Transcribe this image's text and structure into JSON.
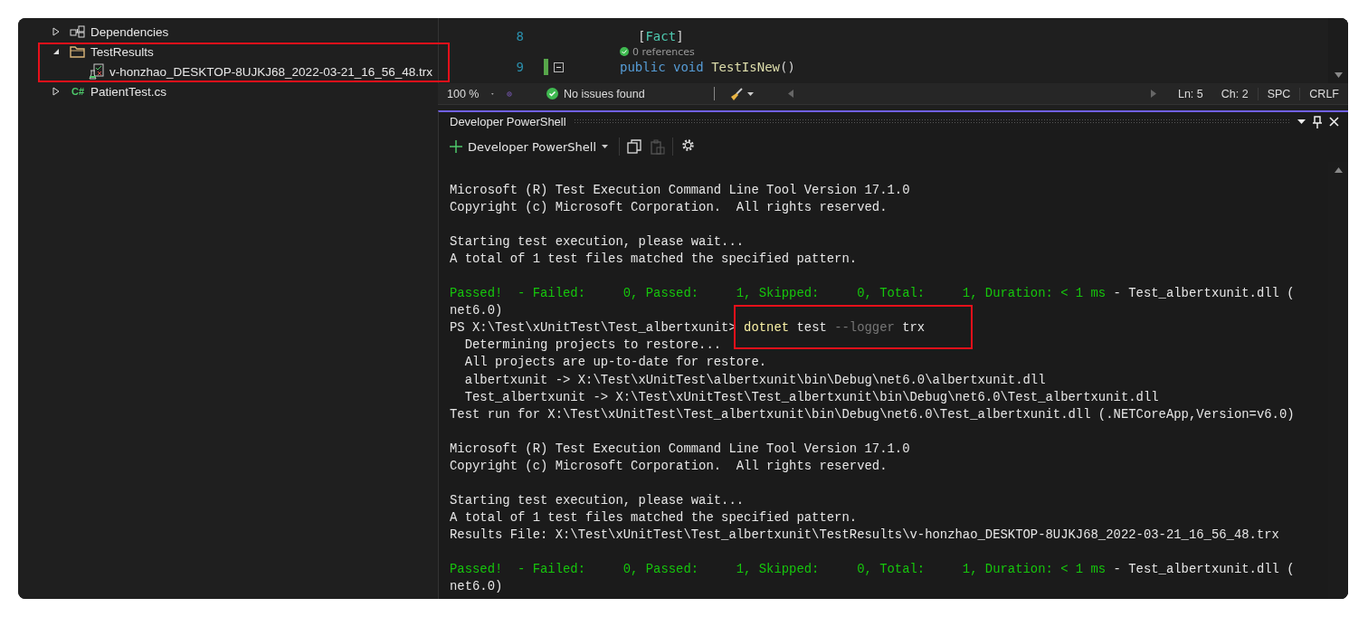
{
  "solution_tree": [
    {
      "label": "Dependencies",
      "kind": "dependencies",
      "expanded": false,
      "highlighted": false
    },
    {
      "label": "TestResults",
      "kind": "folder",
      "expanded": true,
      "highlighted": true,
      "children": [
        {
          "label": "v-honzhao_DESKTOP-8UJKJ68_2022-03-21_16_56_48.trx",
          "kind": "test-file"
        }
      ]
    },
    {
      "label": "PatientTest.cs",
      "kind": "csharp",
      "badge": "C#",
      "expanded": false,
      "highlighted": false
    }
  ],
  "editor": {
    "lines": [
      {
        "number": "8",
        "changed": false,
        "foldable": false,
        "tokens": [
          {
            "text": "[",
            "kind": "plain"
          },
          {
            "text": "Fact",
            "kind": "type"
          },
          {
            "text": "]",
            "kind": "plain"
          }
        ]
      },
      {
        "kind": "codelens",
        "passed": true,
        "text": "0 references"
      },
      {
        "number": "9",
        "changed": true,
        "foldable": true,
        "tokens": [
          {
            "text": "public void ",
            "kind": "keyword"
          },
          {
            "text": "TestIsNew",
            "kind": "method"
          },
          {
            "text": "()",
            "kind": "plain"
          }
        ]
      }
    ]
  },
  "status_bar": {
    "zoom": "100 %",
    "issues": "No issues found",
    "line": "Ln: 5",
    "column": "Ch: 2",
    "indent": "SPC",
    "line_ending": "CRLF"
  },
  "terminal_panel": {
    "title": "Developer PowerShell",
    "profile": "Developer PowerShell",
    "paste_disabled": true,
    "lines": [
      {
        "segments": [
          {
            "text": "Microsoft (R) Test Execution Command Line Tool Version 17.1.0",
            "kind": "plain"
          }
        ]
      },
      {
        "segments": [
          {
            "text": "Copyright (c) Microsoft Corporation.  All rights reserved.",
            "kind": "plain"
          }
        ]
      },
      {
        "kind": "blank"
      },
      {
        "segments": [
          {
            "text": "Starting test execution, please wait...",
            "kind": "plain"
          }
        ]
      },
      {
        "segments": [
          {
            "text": "A total of 1 test files matched the specified pattern.",
            "kind": "plain"
          }
        ]
      },
      {
        "kind": "blank"
      },
      {
        "segments": [
          {
            "text": "Passed!  - Failed:     0, Passed:     1, Skipped:     0, Total:     1, Duration: < 1 ms",
            "kind": "success"
          },
          {
            "text": " - Test_albertxunit.dll (",
            "kind": "plain"
          }
        ]
      },
      {
        "segments": [
          {
            "text": "net6.0)",
            "kind": "plain"
          }
        ]
      },
      {
        "segments": [
          {
            "text": "PS X:\\Test\\xUnitTest\\Test_albertxunit> ",
            "kind": "plain"
          },
          {
            "text": "dotnet",
            "kind": "command",
            "highlighted": true
          },
          {
            "text": " test ",
            "kind": "plain",
            "highlighted": true
          },
          {
            "text": "--logger",
            "kind": "parameter",
            "highlighted": true
          },
          {
            "text": " trx",
            "kind": "plain",
            "highlighted": true
          }
        ]
      },
      {
        "segments": [
          {
            "text": "  Determining projects to restore...",
            "kind": "plain"
          }
        ]
      },
      {
        "segments": [
          {
            "text": "  All projects are up-to-date for restore.",
            "kind": "plain"
          }
        ]
      },
      {
        "segments": [
          {
            "text": "  albertxunit -> X:\\Test\\xUnitTest\\albertxunit\\bin\\Debug\\net6.0\\albertxunit.dll",
            "kind": "plain"
          }
        ]
      },
      {
        "segments": [
          {
            "text": "  Test_albertxunit -> X:\\Test\\xUnitTest\\Test_albertxunit\\bin\\Debug\\net6.0\\Test_albertxunit.dll",
            "kind": "plain"
          }
        ]
      },
      {
        "segments": [
          {
            "text": "Test run for X:\\Test\\xUnitTest\\Test_albertxunit\\bin\\Debug\\net6.0\\Test_albertxunit.dll (.NETCoreApp,Version=v6.0)",
            "kind": "plain"
          }
        ]
      },
      {
        "kind": "blank"
      },
      {
        "segments": [
          {
            "text": "Microsoft (R) Test Execution Command Line Tool Version 17.1.0",
            "kind": "plain"
          }
        ]
      },
      {
        "segments": [
          {
            "text": "Copyright (c) Microsoft Corporation.  All rights reserved.",
            "kind": "plain"
          }
        ]
      },
      {
        "kind": "blank"
      },
      {
        "segments": [
          {
            "text": "Starting test execution, please wait...",
            "kind": "plain"
          }
        ]
      },
      {
        "segments": [
          {
            "text": "A total of 1 test files matched the specified pattern.",
            "kind": "plain"
          }
        ]
      },
      {
        "segments": [
          {
            "text": "Results File: X:\\Test\\xUnitTest\\Test_albertxunit\\TestResults\\v-honzhao_DESKTOP-8UJKJ68_2022-03-21_16_56_48.trx",
            "kind": "plain"
          }
        ]
      },
      {
        "kind": "blank"
      },
      {
        "segments": [
          {
            "text": "Passed!  - Failed:     0, Passed:     1, Skipped:     0, Total:     1, Duration: < 1 ms",
            "kind": "success"
          },
          {
            "text": " - Test_albertxunit.dll (",
            "kind": "plain"
          }
        ]
      },
      {
        "segments": [
          {
            "text": "net6.0)",
            "kind": "plain"
          }
        ]
      }
    ]
  }
}
